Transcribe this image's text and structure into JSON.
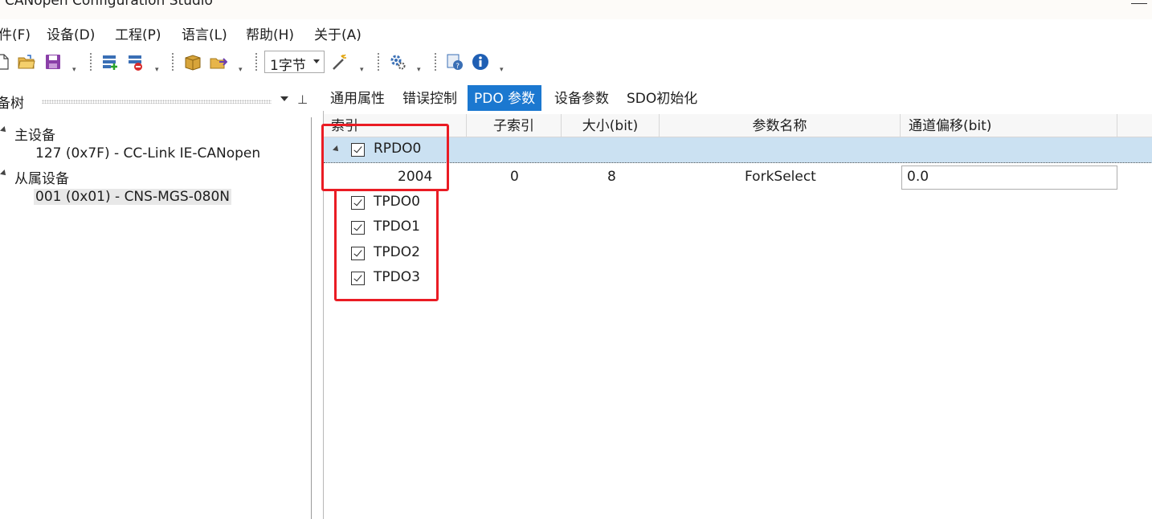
{
  "window": {
    "title": "CANopen Configuration Studio"
  },
  "menu": [
    "件(F)",
    "设备(D)",
    "工程(P)",
    "语言(L)",
    "帮助(H)",
    "关于(A)"
  ],
  "toolbar": {
    "icons": [
      "new-file-icon",
      "open-folder-icon",
      "save-icon",
      "add-device-icon",
      "remove-device-icon",
      "package-icon",
      "export-icon",
      "magic-wand-icon",
      "settings-icon",
      "help-icon",
      "info-icon"
    ],
    "byte_select": "1字节"
  },
  "tree": {
    "title": "备树",
    "master_label": "主设备",
    "master_device": "127 (0x7F)  -  CC-Link IE-CANopen",
    "slave_label": "从属设备",
    "slave_device": "001 (0x01)  -  CNS-MGS-080N"
  },
  "tabs": [
    "通用属性",
    "错误控制",
    "PDO 参数",
    "设备参数",
    "SDO初始化"
  ],
  "active_tab": "PDO 参数",
  "grid": {
    "columns": [
      "索引",
      "子索引",
      "大小(bit)",
      "参数名称",
      "通道偏移(bit)"
    ],
    "group": {
      "name": "RPDO0",
      "checked": true
    },
    "row": {
      "index": "2004",
      "subindex": "0",
      "size": "8",
      "name": "ForkSelect",
      "offset": "0.0"
    },
    "tpdos": [
      {
        "name": "TPDO0",
        "checked": true
      },
      {
        "name": "TPDO1",
        "checked": true
      },
      {
        "name": "TPDO2",
        "checked": true
      },
      {
        "name": "TPDO3",
        "checked": true
      }
    ]
  },
  "colors": {
    "accent": "#1b78d0",
    "selected_row": "#cbe1f2",
    "highlight": "#ea1c24"
  }
}
